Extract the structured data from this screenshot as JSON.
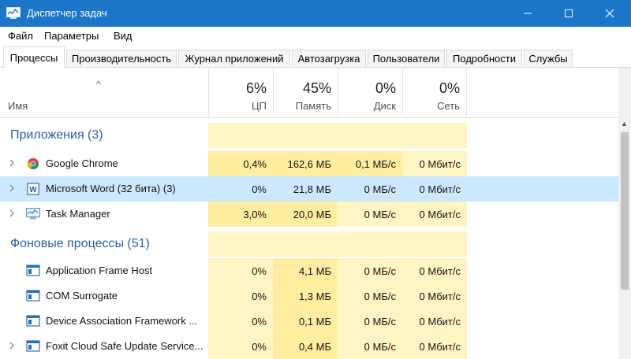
{
  "window": {
    "title": "Диспетчер задач",
    "colors": {
      "titlebar": "#1b75c8",
      "group_title": "#2a5fa8",
      "selected_row": "#cce8ff",
      "heat_light": "#fff4c4",
      "heat_mid": "#ffeda0"
    }
  },
  "menu": {
    "items": [
      "Файл",
      "Параметры",
      "Вид"
    ]
  },
  "tabs": [
    {
      "label": "Процессы",
      "active": true
    },
    {
      "label": "Производительность"
    },
    {
      "label": "Журнал приложений"
    },
    {
      "label": "Автозагрузка"
    },
    {
      "label": "Пользователи"
    },
    {
      "label": "Подробности"
    },
    {
      "label": "Службы"
    }
  ],
  "columns": {
    "name": "Имя",
    "cpu": {
      "pct": "6%",
      "label": "ЦП"
    },
    "memory": {
      "pct": "45%",
      "label": "Память"
    },
    "disk": {
      "pct": "0%",
      "label": "Диск"
    },
    "network": {
      "pct": "0%",
      "label": "Сеть"
    }
  },
  "groups": {
    "apps": {
      "title": "Приложения (3)",
      "rows": [
        {
          "name": "Google Chrome",
          "icon": "chrome-icon",
          "cpu": "0,4%",
          "memory": "162,6 МБ",
          "disk": "0,1 МБ/с",
          "network": "0 Мбит/с",
          "expandable": true
        },
        {
          "name": "Microsoft Word (32 бита) (3)",
          "icon": "word-icon",
          "cpu": "0%",
          "memory": "21,8 МБ",
          "disk": "0 МБ/с",
          "network": "0 Мбит/с",
          "expandable": true,
          "selected": true
        },
        {
          "name": "Task Manager",
          "icon": "task-manager-icon",
          "cpu": "3,0%",
          "memory": "20,0 МБ",
          "disk": "0 МБ/с",
          "network": "0 Мбит/с",
          "expandable": true
        }
      ]
    },
    "background": {
      "title": "Фоновые процессы (51)",
      "rows": [
        {
          "name": "Application Frame Host",
          "icon": "window-process-icon",
          "cpu": "0%",
          "memory": "4,1 МБ",
          "disk": "0 МБ/с",
          "network": "0 Мбит/с"
        },
        {
          "name": "COM Surrogate",
          "icon": "window-process-icon",
          "cpu": "0%",
          "memory": "1,3 МБ",
          "disk": "0 МБ/с",
          "network": "0 Мбит/с"
        },
        {
          "name": "Device Association Framework ...",
          "icon": "window-process-icon",
          "cpu": "0%",
          "memory": "0,1 МБ",
          "disk": "0 МБ/с",
          "network": "0 Мбит/с"
        },
        {
          "name": "Foxit Cloud Safe Update Service...",
          "icon": "window-process-icon",
          "cpu": "0%",
          "memory": "0,4 МБ",
          "disk": "0 МБ/с",
          "network": "0 Мбит/с",
          "expandable": true
        }
      ]
    }
  }
}
